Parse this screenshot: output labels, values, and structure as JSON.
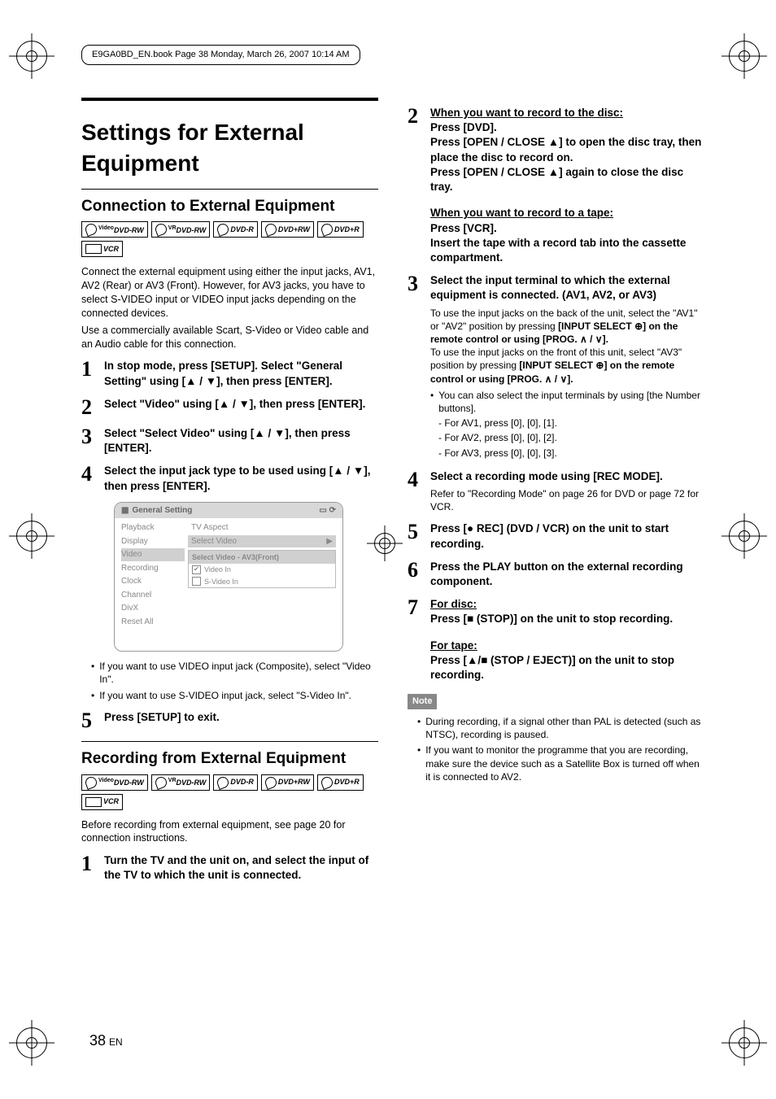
{
  "header_text": "E9GA0BD_EN.book  Page 38  Monday, March 26, 2007  10:14 AM",
  "page_number": "38",
  "page_lang": "EN",
  "main_title": "Settings for External Equipment",
  "section_a": {
    "title": "Connection to External Equipment",
    "badges": [
      "DVD-RW",
      "DVD-RW",
      "DVD-R",
      "DVD+RW",
      "DVD+R",
      "VCR"
    ],
    "badge_sups": [
      "Video",
      "VR",
      "",
      "",
      "",
      ""
    ],
    "intro1": "Connect the external equipment using either the input jacks, AV1, AV2 (Rear) or AV3 (Front). However, for AV3 jacks, you have to select S-VIDEO input or VIDEO input jacks depending on the connected devices.",
    "intro2": "Use a commercially available Scart, S-Video or Video cable and an Audio cable for this connection.",
    "steps": [
      {
        "n": "1",
        "t": "In stop mode, press [SETUP]. Select \"General Setting\" using [▲ / ▼], then press [ENTER]."
      },
      {
        "n": "2",
        "t": "Select \"Video\" using [▲ / ▼], then press [ENTER]."
      },
      {
        "n": "3",
        "t": "Select \"Select Video\" using [▲ / ▼], then press [ENTER]."
      },
      {
        "n": "4",
        "t": "Select the input jack type to be used using [▲ / ▼], then press [ENTER]."
      }
    ],
    "ui": {
      "title": "General Setting",
      "left_items": [
        "Playback",
        "Display",
        "Video",
        "Recording",
        "Clock",
        "Channel",
        "DivX",
        "Reset All"
      ],
      "left_selected_index": 2,
      "right_items": [
        "TV Aspect",
        "Select Video"
      ],
      "right_selected_index": 1,
      "sub_title": "Select Video - AV3(Front)",
      "sub_rows": [
        {
          "checked": true,
          "label": "Video In"
        },
        {
          "checked": false,
          "label": "S-Video In"
        }
      ]
    },
    "post_bullets": [
      "If you want to use VIDEO input jack (Composite), select \"Video In\".",
      "If you want to use S-VIDEO input jack, select \"S-Video In\"."
    ],
    "step5": {
      "n": "5",
      "t": "Press [SETUP] to exit."
    }
  },
  "section_b": {
    "title": "Recording from External Equipment",
    "badges": [
      "DVD-RW",
      "DVD-RW",
      "DVD-R",
      "DVD+RW",
      "DVD+R",
      "VCR"
    ],
    "badge_sups": [
      "Video",
      "VR",
      "",
      "",
      "",
      ""
    ],
    "intro": "Before recording from external equipment, see page 20 for connection instructions.",
    "step1": {
      "n": "1",
      "t": "Turn the TV and the unit on, and select the input of the TV to which the unit is connected."
    }
  },
  "right_col": {
    "step2": {
      "n": "2",
      "disc_head": "When you want to record to the disc:",
      "disc_lines": [
        "Press [DVD].",
        "Press [OPEN / CLOSE ▲] to open the disc tray, then place the disc to record on.",
        "Press [OPEN / CLOSE ▲] again to close the disc tray."
      ],
      "tape_head": "When you want to record to a tape:",
      "tape_lines": [
        "Press [VCR].",
        "Insert the tape with a record tab into the cassette compartment."
      ]
    },
    "step3": {
      "n": "3",
      "head": "Select the input terminal to which the external equipment is connected. (AV1, AV2, or AV3)",
      "body1": "To use the input jacks on the back of the unit, select the \"AV1\" or \"AV2\" position by pressing",
      "body1b": "[INPUT SELECT ⊕] on the remote control or using [PROG. ∧ / ∨].",
      "body2": "To use the input jacks on the front of this unit, select \"AV3\" position by pressing",
      "body2b": "[INPUT SELECT ⊕] on the remote control or using [PROG. ∧ / ∨].",
      "sub_bullet": "You can also select the input terminals by using [the Number buttons].",
      "sub_lines": [
        "For AV1, press [0], [0], [1].",
        "For AV2, press [0], [0], [2].",
        "For AV3, press [0], [0], [3]."
      ]
    },
    "step4": {
      "n": "4",
      "head": "Select a recording mode using [REC MODE].",
      "sub": "Refer to \"Recording Mode\" on page 26 for DVD or page 72 for VCR."
    },
    "step5": {
      "n": "5",
      "head": "Press [● REC] (DVD / VCR) on the unit to start recording."
    },
    "step6": {
      "n": "6",
      "head": "Press the PLAY button on the external recording component."
    },
    "step7": {
      "n": "7",
      "disc_head": "For disc:",
      "disc_line": "Press [■ (STOP)] on the unit to stop recording.",
      "tape_head": "For tape:",
      "tape_line": "Press [▲/■ (STOP / EJECT)] on the unit to stop recording."
    },
    "note_label": "Note",
    "notes": [
      "During recording, if a signal other than PAL is detected (such as NTSC), recording is paused.",
      "If you want to monitor the programme that you are recording, make sure the device such as a Satellite Box is turned off when it is connected to AV2."
    ]
  }
}
